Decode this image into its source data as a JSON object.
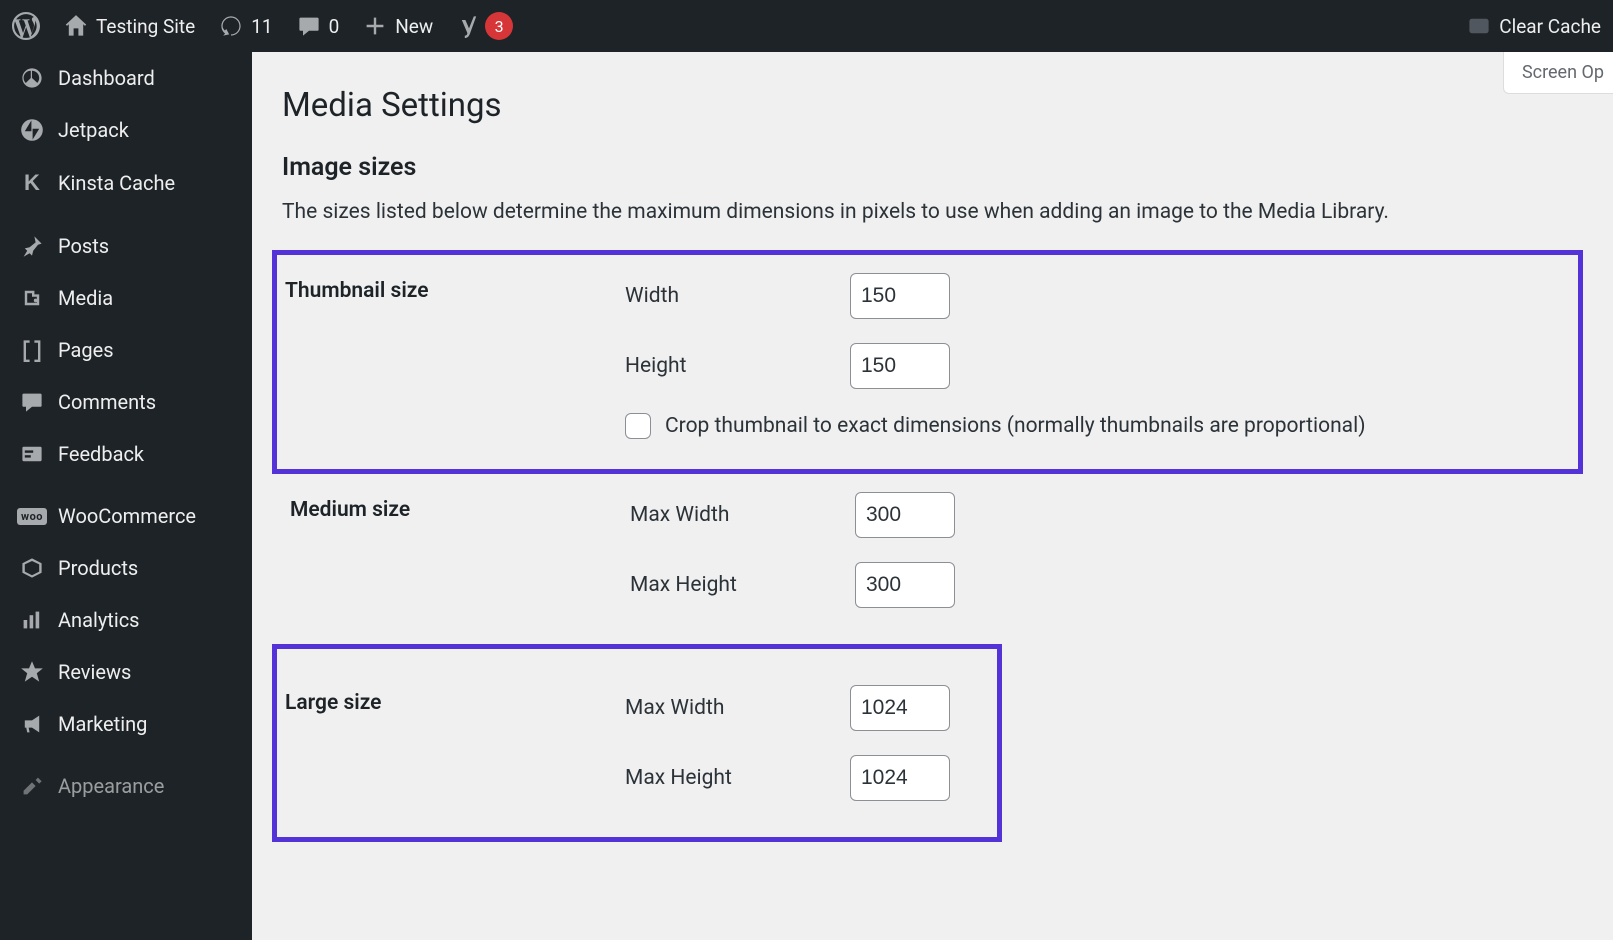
{
  "adminbar": {
    "site_name": "Testing Site",
    "updates_count": "11",
    "comments_count": "0",
    "new_label": "New",
    "yoast_badge": "3",
    "clear_cache": "Clear Cache"
  },
  "sidebar": {
    "items": [
      {
        "label": "Dashboard",
        "icon": "dashboard"
      },
      {
        "label": "Jetpack",
        "icon": "jetpack"
      },
      {
        "label": "Kinsta Cache",
        "icon": "kinsta"
      },
      {
        "label": "Posts",
        "icon": "pin"
      },
      {
        "label": "Media",
        "icon": "media"
      },
      {
        "label": "Pages",
        "icon": "pages"
      },
      {
        "label": "Comments",
        "icon": "comment"
      },
      {
        "label": "Feedback",
        "icon": "feedback"
      },
      {
        "label": "WooCommerce",
        "icon": "woo"
      },
      {
        "label": "Products",
        "icon": "products"
      },
      {
        "label": "Analytics",
        "icon": "analytics"
      },
      {
        "label": "Reviews",
        "icon": "star"
      },
      {
        "label": "Marketing",
        "icon": "marketing"
      },
      {
        "label": "Appearance",
        "icon": "appearance"
      }
    ]
  },
  "screen_options": "Screen Op",
  "page": {
    "title": "Media Settings",
    "section_title": "Image sizes",
    "section_desc": "The sizes listed below determine the maximum dimensions in pixels to use when adding an image to the Media Library.",
    "thumbnail": {
      "label": "Thumbnail size",
      "width_label": "Width",
      "width_value": "150",
      "height_label": "Height",
      "height_value": "150",
      "crop_label": "Crop thumbnail to exact dimensions (normally thumbnails are proportional)"
    },
    "medium": {
      "label": "Medium size",
      "max_width_label": "Max Width",
      "max_width_value": "300",
      "max_height_label": "Max Height",
      "max_height_value": "300"
    },
    "large": {
      "label": "Large size",
      "max_width_label": "Max Width",
      "max_width_value": "1024",
      "max_height_label": "Max Height",
      "max_height_value": "1024"
    }
  }
}
